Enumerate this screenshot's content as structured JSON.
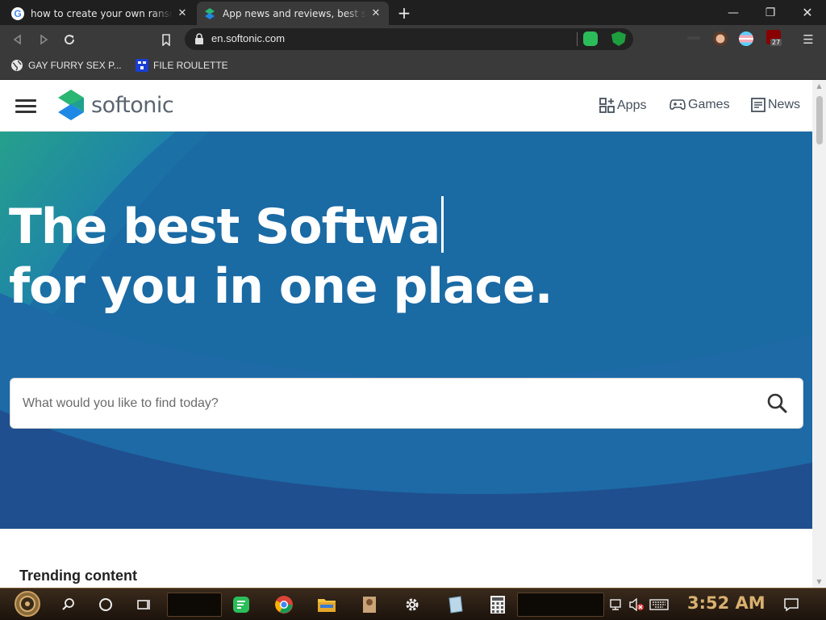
{
  "browser": {
    "tabs": [
      {
        "title": "how to create your own ransomware",
        "favicon": "google-icon",
        "active": false
      },
      {
        "title": "App news and reviews, best software",
        "favicon": "softonic-icon",
        "active": true
      }
    ],
    "close_glyph": "✕",
    "new_tab_glyph": "+",
    "window_controls": {
      "minimize": "—",
      "restore": "❐",
      "close": "✕"
    },
    "url": "en.softonic.com",
    "extension_badge": "27",
    "bookmarks": [
      {
        "label": "GAY FURRY SEX P...",
        "icon": "globe-icon"
      },
      {
        "label": "FILE ROULETTE",
        "icon": "file-roulette-icon"
      }
    ]
  },
  "site": {
    "logo_text": "softonic",
    "nav": {
      "apps": "Apps",
      "games": "Games",
      "news": "News"
    },
    "hero": {
      "line1": "The best Softwa",
      "line2": "for you in one place."
    },
    "search": {
      "placeholder": "What would you like to find today?"
    },
    "trending_heading": "Trending content",
    "colors": {
      "hero_blue": "#1a6aa4",
      "brand_green": "#2bb673",
      "brand_blue": "#1e88e5"
    }
  },
  "taskbar": {
    "time": "3:52 AM"
  }
}
